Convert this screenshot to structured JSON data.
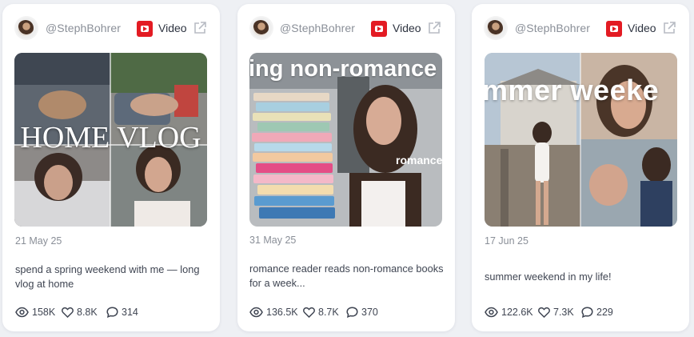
{
  "cards": [
    {
      "handle": "@StephBohrer",
      "type_label": "Video",
      "thumbnail_text": "HOME VLOG",
      "date": "21 May 25",
      "title": "spend a spring weekend with me — long vlog at home",
      "views": "158K",
      "likes": "8.8K",
      "comments": "314"
    },
    {
      "handle": "@StephBohrer",
      "type_label": "Video",
      "thumbnail_text": "ing non-romance b",
      "thumbnail_side_text": "romance",
      "date": "31 May 25",
      "title": "romance reader reads non-romance books for a week...",
      "views": "136.5K",
      "likes": "8.7K",
      "comments": "370"
    },
    {
      "handle": "@StephBohrer",
      "type_label": "Video",
      "thumbnail_text": "mmer weeke",
      "date": "17 Jun 25",
      "title": "summer weekend in my life!",
      "views": "122.6K",
      "likes": "7.3K",
      "comments": "229"
    }
  ],
  "colors": {
    "page_bg": "#eef0f4",
    "card_bg": "#ffffff",
    "youtube_red": "#e31b23",
    "muted_text": "#8a8f98",
    "body_text": "#3f4552"
  },
  "icons": [
    "avatar",
    "youtube-icon",
    "external-link-icon",
    "eye-icon",
    "heart-icon",
    "comment-icon"
  ]
}
